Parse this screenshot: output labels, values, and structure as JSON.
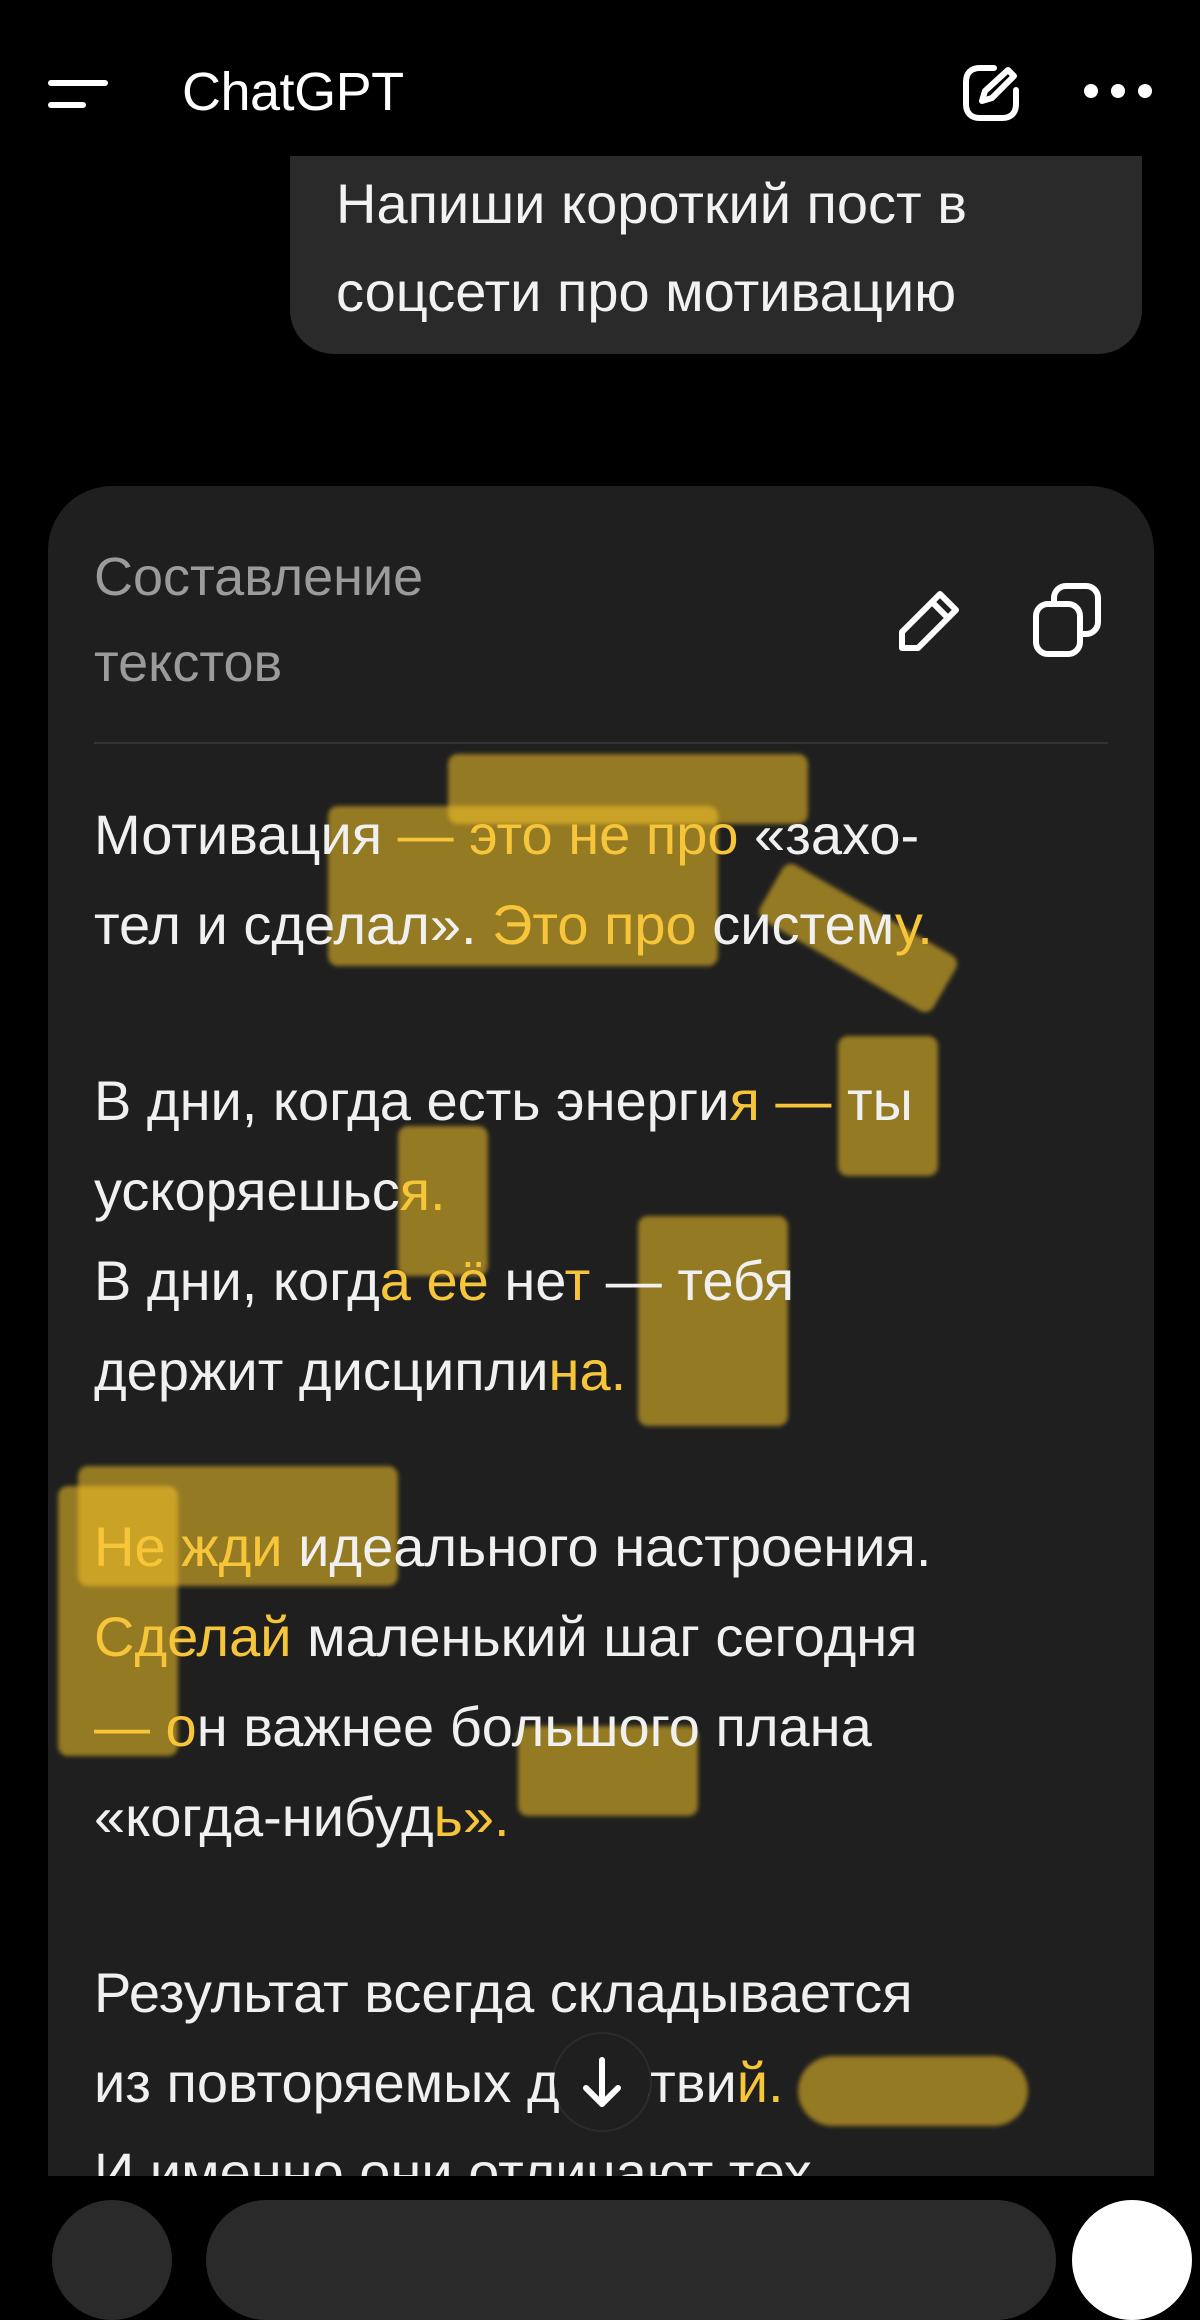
{
  "header": {
    "title": "ChatGPT",
    "menu_icon": "menu-icon",
    "new_chat_icon": "compose-icon",
    "more_icon": "more-horizontal-icon"
  },
  "user_message": {
    "lines": [
      "Напиши короткий пост в",
      "соцсети про мотивацию"
    ]
  },
  "canvas": {
    "title_lines": [
      "Составление",
      "текстов"
    ],
    "edit_icon": "pencil-icon",
    "copy_icon": "copy-icon",
    "accent_color": "#f7c53a",
    "paragraphs": [
      [
        [
          {
            "t": "Мотивация "
          },
          {
            "t": "— это не про",
            "hl": true
          },
          {
            "t": " «захо-"
          }
        ],
        [
          {
            "t": "тел и сделал». "
          },
          {
            "t": "Это про",
            "hl": true
          },
          {
            "t": " систем"
          },
          {
            "t": "у.",
            "hl": true
          }
        ]
      ],
      [
        [
          {
            "t": "В дни, когда есть энерги"
          },
          {
            "t": "я —",
            "hl": true
          },
          {
            "t": " ты"
          }
        ],
        [
          {
            "t": "ускоряешьс"
          },
          {
            "t": "я.",
            "hl": true
          }
        ],
        [
          {
            "t": "В дни, когд"
          },
          {
            "t": "а её",
            "hl": true
          },
          {
            "t": " не"
          },
          {
            "t": "т",
            "hl": true
          },
          {
            "t": " — тебя"
          }
        ],
        [
          {
            "t": "держит дисципли"
          },
          {
            "t": "на.",
            "hl": true
          }
        ]
      ],
      [
        [
          {
            "t": "Не жди",
            "hl": true
          },
          {
            "t": " идеального настроения."
          }
        ],
        [
          {
            "t": "Сделай",
            "hl": true
          },
          {
            "t": " маленький шаг сегодня"
          }
        ],
        [
          {
            "t": "— о",
            "hl": true
          },
          {
            "t": "н важнее большого плана"
          }
        ],
        [
          {
            "t": "«когда-нибуд"
          },
          {
            "t": "ь».",
            "hl": true
          }
        ]
      ],
      [
        [
          {
            "t": "Результат всегда складывается"
          }
        ],
        [
          {
            "t": "из повторяемы"
          },
          {
            "t": "х д"
          },
          {
            "t": "ействи"
          },
          {
            "t": "й.",
            "hl": true
          }
        ],
        [
          {
            "t": "И именно они отличают тех."
          }
        ]
      ]
    ]
  },
  "scroll_down_icon": "arrow-down-icon"
}
